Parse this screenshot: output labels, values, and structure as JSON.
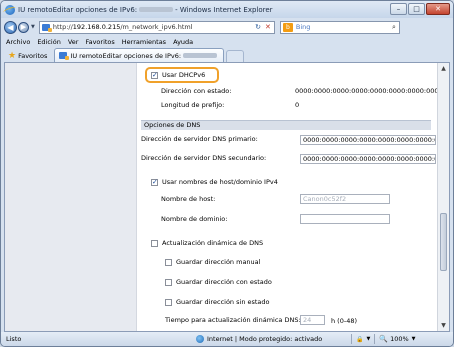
{
  "window": {
    "title_prefix": "IU remotoEditar opciones de IPv6:",
    "title_suffix": "- Windows Internet Explorer",
    "buttons": {
      "minimize": "–",
      "maximize": "□",
      "close": "✕"
    }
  },
  "address_bar": {
    "url_prefix": "http://",
    "url_host": "192.168.0.215",
    "url_path": "/m_network_ipv6.html",
    "refresh_icon": "↻",
    "stop_icon": "✕"
  },
  "search": {
    "placeholder": "Bing",
    "logo": "b",
    "icon": "⌕"
  },
  "menu": {
    "items": [
      "Archivo",
      "Edición",
      "Ver",
      "Favoritos",
      "Herramientas",
      "Ayuda"
    ]
  },
  "favorites_bar": {
    "favorites_label": "Favoritos",
    "tab_title": "IU remotoEditar opciones de IPv6:"
  },
  "form": {
    "use_dhcpv6_label": "Usar DHCPv6",
    "status_address_label": "Dirección con estado:",
    "status_address_value": "0000:0000:0000:0000:0000:0000:0000:0000",
    "prefix_length_label": "Longitud de prefijo:",
    "prefix_length_value": "0",
    "dns_section_title": "Opciones de DNS",
    "primary_dns_label": "Dirección de servidor DNS primario:",
    "primary_dns_value": "0000:0000:0000:0000:0000:0000:0000:0000",
    "secondary_dns_label": "Dirección de servidor DNS secundario:",
    "secondary_dns_value": "0000:0000:0000:0000:0000:0000:0000:0000",
    "use_host_domain_label": "Usar nombres de host/dominio IPv4",
    "host_name_label": "Nombre de host:",
    "host_name_value": "Canon0c52f2",
    "domain_name_label": "Nombre de dominio:",
    "domain_name_value": "",
    "dynamic_dns_label": "Actualización dinámica de DNS",
    "save_manual_label": "Guardar dirección manual",
    "save_stateful_label": "Guardar dirección con estado",
    "save_stateless_label": "Guardar dirección sin estado",
    "interval_label": "Tiempo para actualización dinámica DNS:",
    "interval_value": "24",
    "interval_unit": "h (0-48)"
  },
  "checkboxes": {
    "use_dhcpv6": true,
    "use_host_domain": true,
    "dynamic_dns": false,
    "save_manual": false,
    "save_stateful": false,
    "save_stateless": false
  },
  "status_bar": {
    "left_text": "Listo",
    "zone_text": "Internet | Modo protegido: activado",
    "zoom_text": "100%",
    "security_icon": "🔒"
  },
  "colors": {
    "highlight": "#f0a12a",
    "accent": "#1e4e9a",
    "section_bg": "#d9dfe9"
  }
}
